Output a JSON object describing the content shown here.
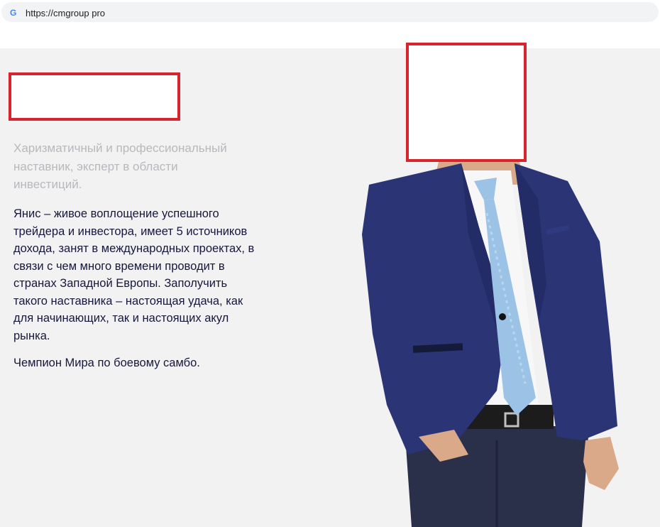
{
  "browser": {
    "url": "https://cmgroup pro",
    "favicon_letter": "G"
  },
  "content": {
    "tagline": "Харизматичный и профессиональный наставник, эксперт в области инвестиций.",
    "bio_paragraph_1": "Янис – живое воплощение успешного трейдера и инвестора, имеет 5 источников дохода, занят в международных проектах, в связи с чем много времени проводит в странах Западной Европы. Заполучить такого наставника – настоящая удача, как для начинающих, так и настоящих акул рынка.",
    "bio_paragraph_2": "Чемпион Мира по боевому самбо."
  },
  "colors": {
    "redaction_border": "#d9232d",
    "page_background": "#f2f2f3",
    "tagline_text": "#b8b8bd",
    "body_text": "#17173d",
    "jacket": "#2b3576",
    "tie": "#9cc3e6",
    "jeans": "#2a2f4a"
  }
}
